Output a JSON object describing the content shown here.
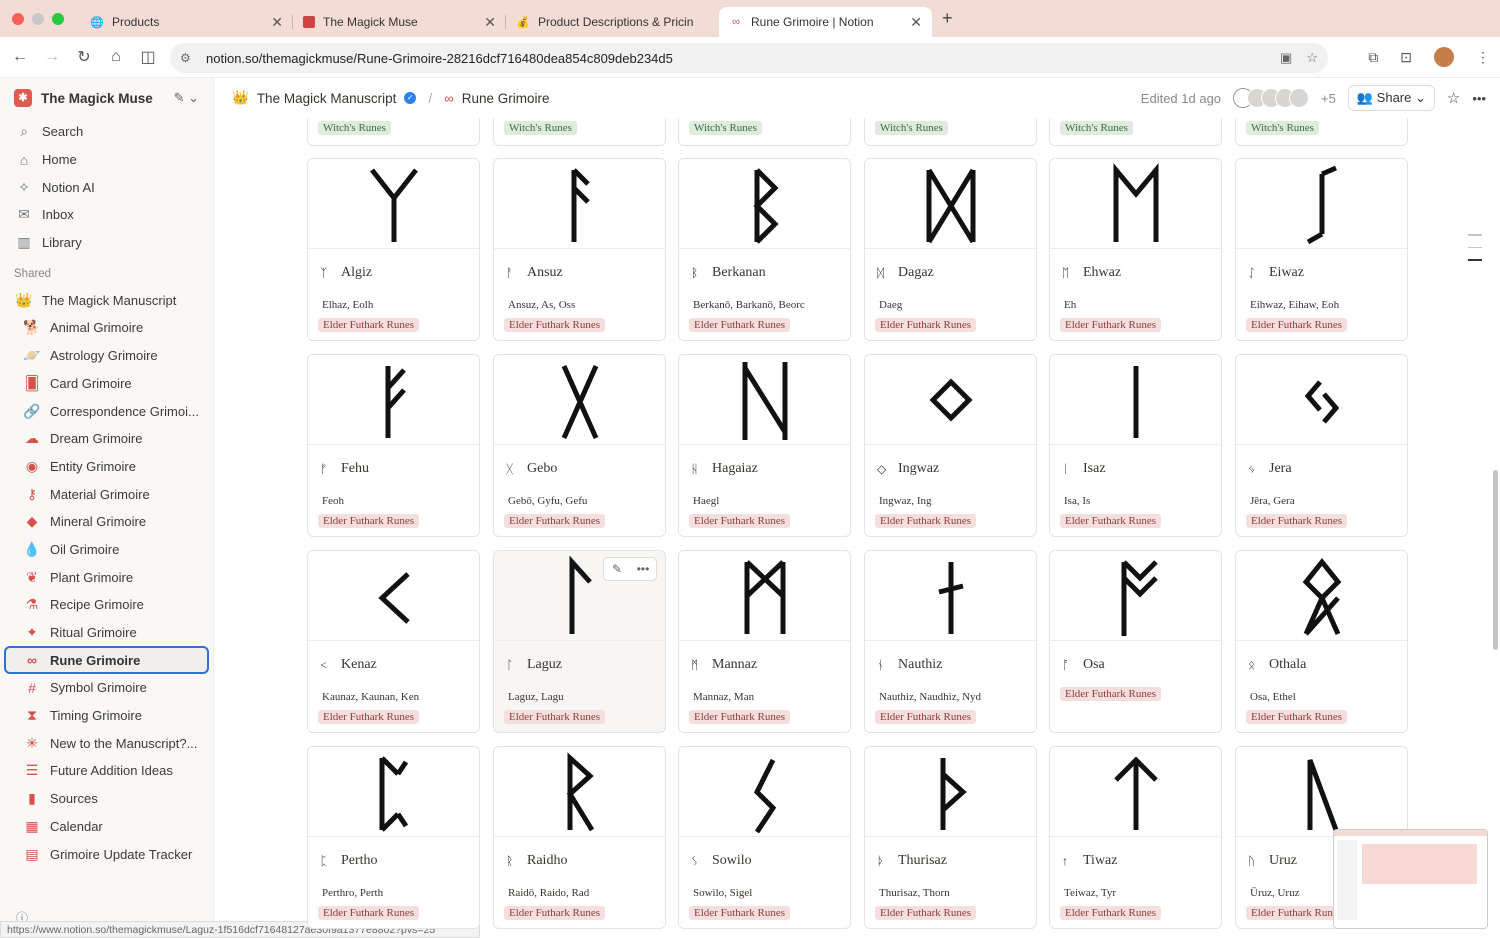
{
  "browser": {
    "tabs": [
      {
        "label": "Products",
        "icon": "globe-icon"
      },
      {
        "label": "The Magick Muse",
        "icon": "magick-muse-favicon"
      },
      {
        "label": "Product Descriptions & Pricin",
        "icon": "moneybag-icon"
      },
      {
        "label": "Rune Grimoire | Notion",
        "icon": "infinity-icon"
      }
    ],
    "url": "notion.so/themagickmuse/Rune-Grimoire-28216dcf716480dea854c809deb234d5",
    "status_url": "https://www.notion.so/themagickmuse/Laguz-1f516dcf71648127ae30f9a1377e8802?pvs=25"
  },
  "sidebar": {
    "workspace": "The Magick Muse",
    "top_items": [
      {
        "label": "Search",
        "icon": "search-icon"
      },
      {
        "label": "Home",
        "icon": "home-icon"
      },
      {
        "label": "Notion AI",
        "icon": "ai-icon"
      },
      {
        "label": "Inbox",
        "icon": "inbox-icon"
      },
      {
        "label": "Library",
        "icon": "library-icon"
      }
    ],
    "shared_heading": "Shared",
    "shared_items": [
      {
        "label": "The Magick Manuscript",
        "icon": "crown-icon"
      },
      {
        "label": "Animal Grimoire",
        "icon": "animal-icon"
      },
      {
        "label": "Astrology Grimoire",
        "icon": "planet-icon"
      },
      {
        "label": "Card Grimoire",
        "icon": "cards-icon"
      },
      {
        "label": "Correspondence Grimoi...",
        "icon": "link-icon"
      },
      {
        "label": "Dream Grimoire",
        "icon": "cloud-icon"
      },
      {
        "label": "Entity Grimoire",
        "icon": "eye-icon"
      },
      {
        "label": "Material Grimoire",
        "icon": "key-icon"
      },
      {
        "label": "Mineral Grimoire",
        "icon": "gem-icon"
      },
      {
        "label": "Oil Grimoire",
        "icon": "drop-icon"
      },
      {
        "label": "Plant Grimoire",
        "icon": "leaf-icon"
      },
      {
        "label": "Recipe Grimoire",
        "icon": "flask-icon"
      },
      {
        "label": "Ritual Grimoire",
        "icon": "wand-icon"
      },
      {
        "label": "Rune Grimoire",
        "icon": "infinity-icon"
      },
      {
        "label": "Symbol Grimoire",
        "icon": "hash-icon"
      },
      {
        "label": "Timing Grimoire",
        "icon": "hourglass-icon"
      },
      {
        "label": "New to the Manuscript?...",
        "icon": "sparkle-icon"
      },
      {
        "label": "Future Addition Ideas",
        "icon": "list-icon"
      },
      {
        "label": "Sources",
        "icon": "book-icon"
      },
      {
        "label": "Calendar",
        "icon": "calendar-icon"
      },
      {
        "label": "Grimoire Update Tracker",
        "icon": "tracker-icon"
      }
    ]
  },
  "header": {
    "parent": "The Magick Manuscript",
    "page": "Rune Grimoire",
    "edited": "Edited 1d ago",
    "extra_count": "+5",
    "share": "Share"
  },
  "grid": {
    "top_partial_tags": [
      "Witch's Runes",
      "Witch's Runes",
      "Witch's Runes",
      "Witch's Runes",
      "Witch's Runes",
      "Witch's Runes"
    ],
    "cards": [
      {
        "name": "Algiz",
        "glyph": "ᛉ",
        "alias": "Elhaz, Eolh",
        "tag": "Elder Futhark Runes"
      },
      {
        "name": "Ansuz",
        "glyph": "ᚨ",
        "alias": "Ansuz, As, Oss",
        "tag": "Elder Futhark Runes"
      },
      {
        "name": "Berkanan",
        "glyph": "ᛒ",
        "alias": "Berkanō, Barkanō, Beorc",
        "tag": "Elder Futhark Runes"
      },
      {
        "name": "Dagaz",
        "glyph": "ᛞ",
        "alias": "Daeg",
        "tag": "Elder Futhark Runes"
      },
      {
        "name": "Ehwaz",
        "glyph": "ᛖ",
        "alias": "Eh",
        "tag": "Elder Futhark Runes"
      },
      {
        "name": "Eiwaz",
        "glyph": "ᛇ",
        "alias": "Eihwaz, Eihaw, Eoh",
        "tag": "Elder Futhark Runes"
      },
      {
        "name": "Fehu",
        "glyph": "ᚠ",
        "alias": "Feoh",
        "tag": "Elder Futhark Runes"
      },
      {
        "name": "Gebo",
        "glyph": "ᚷ",
        "alias": "Gebō, Gyfu, Gefu",
        "tag": "Elder Futhark Runes"
      },
      {
        "name": "Hagaiaz",
        "glyph": "ᚺ",
        "alias": "Haegl",
        "tag": "Elder Futhark Runes"
      },
      {
        "name": "Ingwaz",
        "glyph": "◇",
        "alias": "Ingwaz, Ing",
        "tag": "Elder Futhark Runes"
      },
      {
        "name": "Isaz",
        "glyph": "ᛁ",
        "alias": "Isa, Is",
        "tag": "Elder Futhark Runes"
      },
      {
        "name": "Jera",
        "glyph": "ᛃ",
        "alias": "Jēra, Gera",
        "tag": "Elder Futhark Runes"
      },
      {
        "name": "Kenaz",
        "glyph": "<",
        "alias": "Kaunaz, Kaunan, Ken",
        "tag": "Elder Futhark Runes"
      },
      {
        "name": "Laguz",
        "glyph": "ᛚ",
        "alias": "Laguz, Lagu",
        "tag": "Elder Futhark Runes"
      },
      {
        "name": "Mannaz",
        "glyph": "ᛗ",
        "alias": "Mannaz, Man",
        "tag": "Elder Futhark Runes"
      },
      {
        "name": "Nauthiz",
        "glyph": "ᚾ",
        "alias": "Nauthiz, Naudhiz, Nyd",
        "tag": "Elder Futhark Runes"
      },
      {
        "name": "Osa",
        "glyph": "ᚩ",
        "alias": "",
        "tag": "Elder Futhark Runes"
      },
      {
        "name": "Othala",
        "glyph": "ᛟ",
        "alias": "Osa, Ethel",
        "tag": "Elder Futhark Runes"
      },
      {
        "name": "Pertho",
        "glyph": "ᛈ",
        "alias": "Perthro, Perth",
        "tag": "Elder Futhark Runes"
      },
      {
        "name": "Raidho",
        "glyph": "ᚱ",
        "alias": "Raidō, Raido, Rad",
        "tag": "Elder Futhark Runes"
      },
      {
        "name": "Sowilo",
        "glyph": "ᛊ",
        "alias": "Sowilo, Sigel",
        "tag": "Elder Futhark Runes"
      },
      {
        "name": "Thurisaz",
        "glyph": "ᚦ",
        "alias": "Thurisaz, Thorn",
        "tag": "Elder Futhark Runes"
      },
      {
        "name": "Tiwaz",
        "glyph": "↑",
        "alias": "Teiwaz, Tyr",
        "tag": "Elder Futhark Runes"
      },
      {
        "name": "Uruz",
        "glyph": "ᚢ",
        "alias": "Ūruz, Uruz",
        "tag": "Elder Futhark Runes"
      }
    ]
  }
}
